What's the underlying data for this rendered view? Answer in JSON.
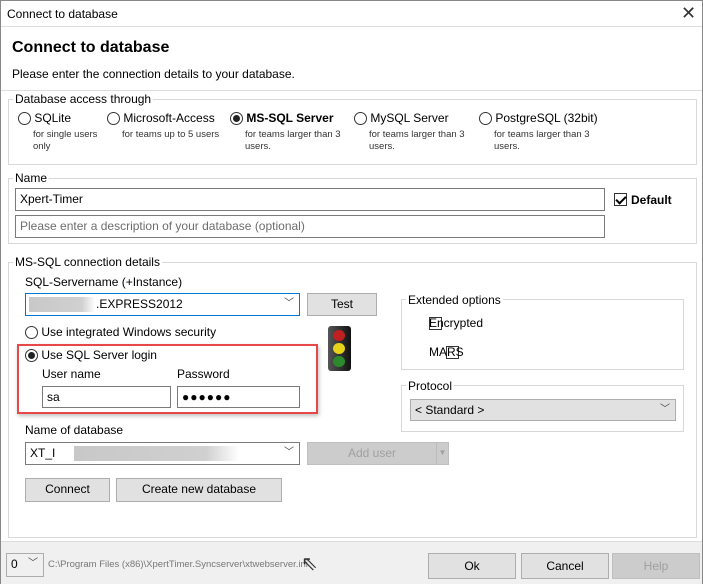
{
  "window": {
    "title": "Connect to database",
    "close_icon": "close-icon"
  },
  "header": {
    "title": "Connect to database",
    "subtitle": "Please enter the connection details to your database."
  },
  "access": {
    "legend": "Database access through",
    "options": [
      {
        "label": "SQLite",
        "desc1": "for single users",
        "desc2": "only",
        "selected": false
      },
      {
        "label": "Microsoft-Access",
        "desc1": "for teams up to 5 users",
        "desc2": "",
        "selected": false
      },
      {
        "label": "MS-SQL Server",
        "desc1": "for teams larger than 3",
        "desc2": "users.",
        "selected": true
      },
      {
        "label": "MySQL Server",
        "desc1": "for teams larger than 3",
        "desc2": "users.",
        "selected": false
      },
      {
        "label": "PostgreSQL (32bit)",
        "desc1": "for teams larger than 3",
        "desc2": "users.",
        "selected": false
      }
    ]
  },
  "name": {
    "legend": "Name",
    "value": "Xpert-Timer",
    "description_placeholder": "Please enter a description of your database (optional)",
    "default_label": "Default",
    "default_checked": true
  },
  "mssql": {
    "legend": "MS-SQL connection details",
    "servername_label": "SQL-Servername (+Instance)",
    "servername_value": ".EXPRESS2012",
    "test_label": "Test",
    "integrated_label": "Use integrated Windows security",
    "sql_login_label": "Use SQL Server login",
    "username_label": "User name",
    "username_value": "sa",
    "password_label": "Password",
    "password_value": "●●●●●●",
    "dbname_label": "Name of database",
    "dbname_value": "XT_I",
    "add_user_label": "Add user",
    "connect_label": "Connect",
    "create_label": "Create new database",
    "extended_legend": "Extended options",
    "encrypted_label": "Encrypted",
    "mars_label": "MARS",
    "protocol_legend": "Protocol",
    "protocol_value": "< Standard >"
  },
  "footer": {
    "index_value": "0",
    "path": "C:\\Program Files (x86)\\XpertTimer.Syncserver\\xtwebserver.ini",
    "ok_label": "Ok",
    "cancel_label": "Cancel",
    "help_label": "Help"
  },
  "colors": {
    "highlight_box": "#e8474a",
    "focus_border": "#0078d7"
  }
}
